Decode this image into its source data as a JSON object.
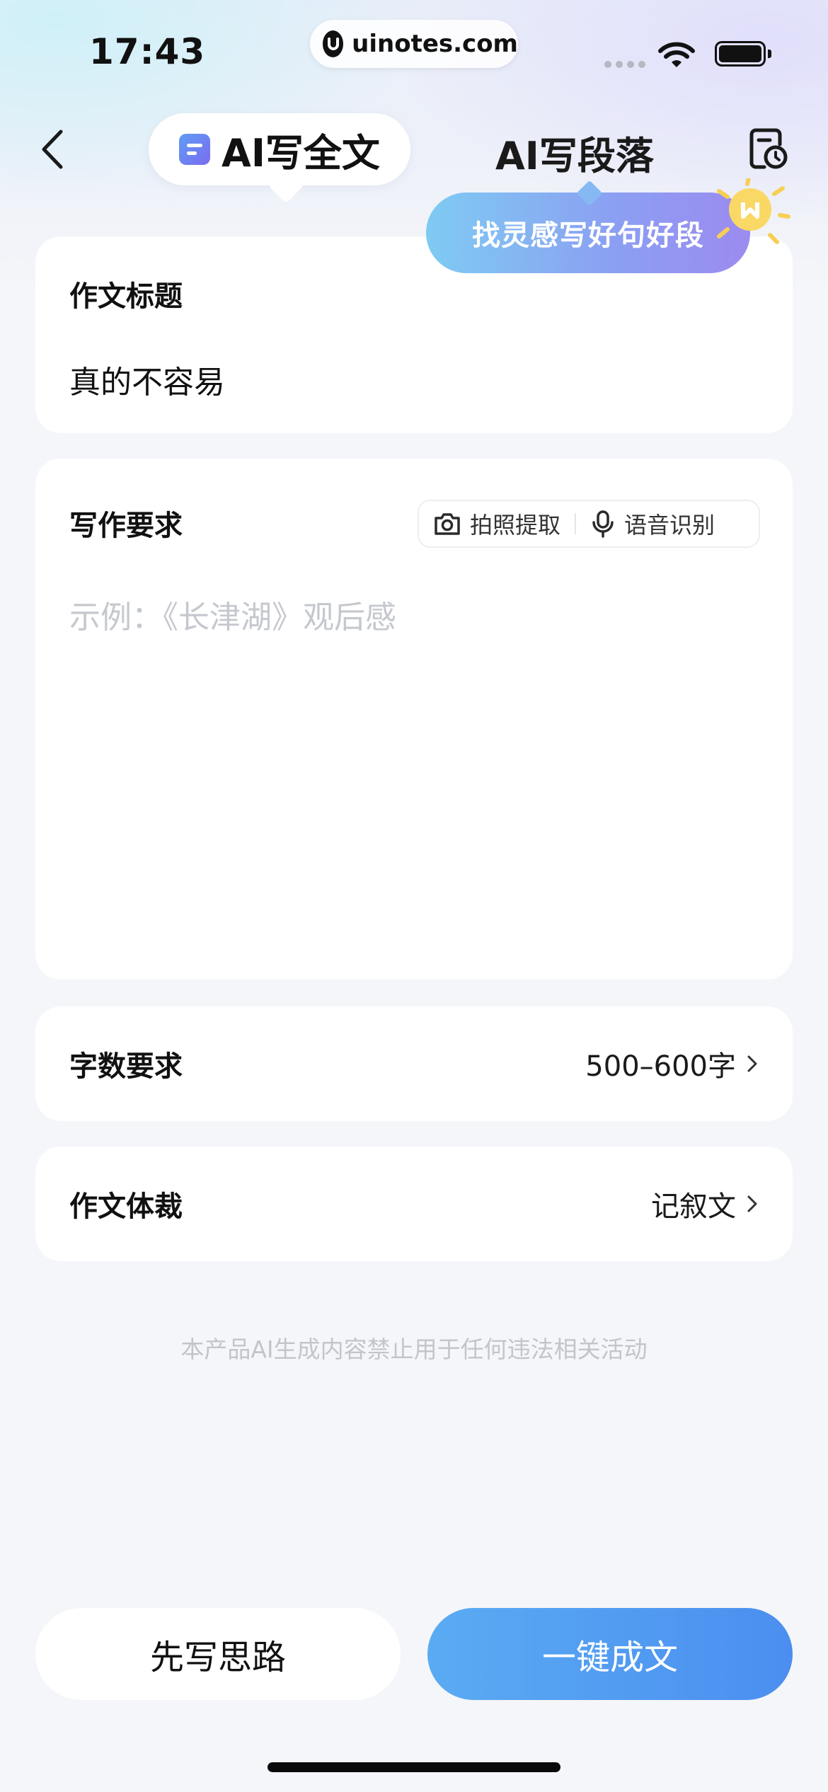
{
  "status_bar": {
    "time": "17:43",
    "url": "uinotes.com"
  },
  "header": {
    "back_icon": "chevron-left-icon",
    "tab_active_label": "AI写全文",
    "tab_inactive_label": "AI写段落",
    "history_icon": "document-clock-icon",
    "tooltip_text": "找灵感写好句好段"
  },
  "title_card": {
    "label": "作文标题",
    "value": "真的不容易"
  },
  "requirement_card": {
    "label": "写作要求",
    "photo_label": "拍照提取",
    "voice_label": "语音识别",
    "placeholder": "示例：《长津湖》观后感"
  },
  "word_count": {
    "label": "字数要求",
    "value": "500–600字"
  },
  "genre": {
    "label": "作文体裁",
    "value": "记叙文"
  },
  "disclaimer": "本产品AI生成内容禁止用于任何违法相关活动",
  "actions": {
    "outline_label": "先写思路",
    "generate_label": "一键成文"
  },
  "colors": {
    "primary_gradient_start": "#5aabf3",
    "primary_gradient_end": "#4b8ef0",
    "tooltip_gradient_start": "#7ecbf3",
    "tooltip_gradient_end": "#9c8bf0"
  }
}
